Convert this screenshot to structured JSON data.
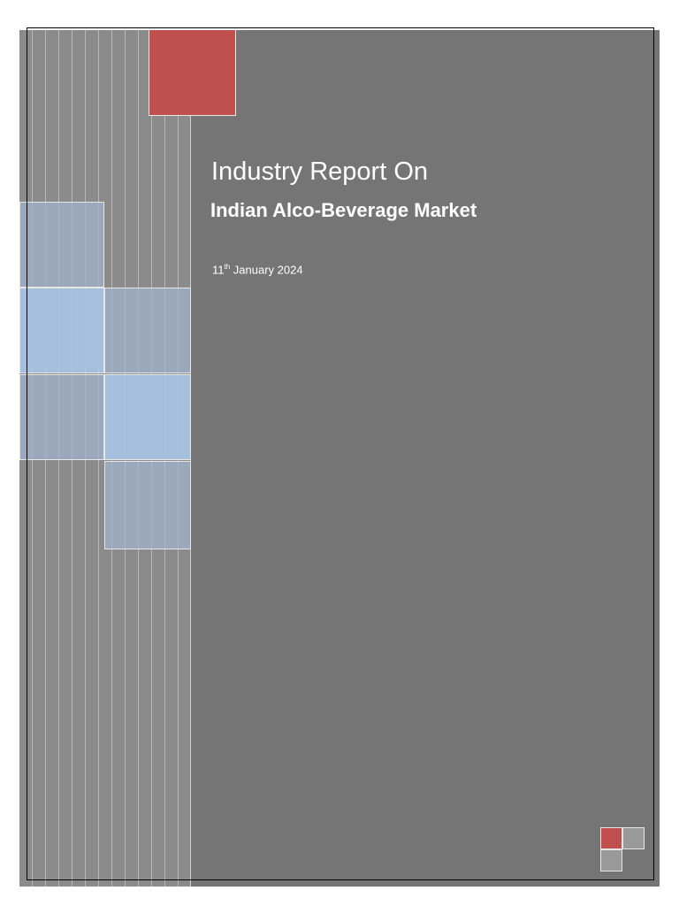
{
  "cover": {
    "title": "Industry Report On",
    "subtitle": "Indian Alco-Beverage Market",
    "date_day": "11",
    "date_suffix": "th",
    "date_rest": " January 2024"
  },
  "colors": {
    "background": "#757575",
    "stripe_panel": "#8b8b8b",
    "accent_red": "#c0504d",
    "accent_blue": "#a8c4e4"
  }
}
